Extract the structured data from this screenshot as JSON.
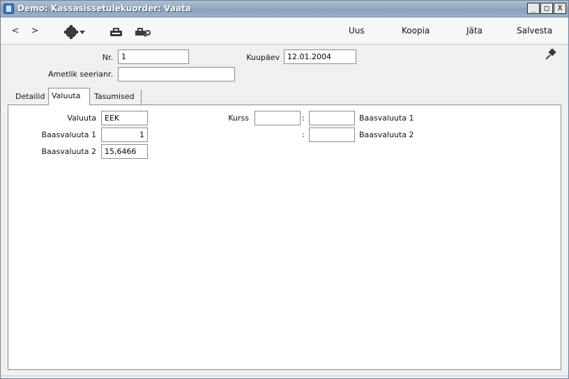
{
  "window": {
    "title": "Demo: Kassasissetulekuorder: Vaata",
    "controls": {
      "minimize": "_",
      "maximize": "□",
      "close": "X"
    }
  },
  "toolbar": {
    "back": "<",
    "forward": ">",
    "icons": [
      "gear-icon",
      "printer-icon",
      "print-preview-icon"
    ],
    "new_label": "Uus",
    "copy_label": "Koopia",
    "skip_label": "Jäta",
    "save_label": "Salvesta"
  },
  "header": {
    "nr_label": "Nr.",
    "nr_value": "1",
    "date_label": "Kuupäev",
    "date_value": "12.01.2004",
    "serial_label": "Ametlik seerianr.",
    "serial_value": ""
  },
  "tabs": [
    {
      "label": "Detailid",
      "active": false
    },
    {
      "label": "Valuuta",
      "active": true
    },
    {
      "label": "Tasumised",
      "active": false
    }
  ],
  "currency": {
    "currency_label": "Valuuta",
    "currency_value": "EEK",
    "base1_label": "Baasvaluuta 1",
    "base1_value": "1",
    "base2_label": "Baasvaluuta 2",
    "base2_value": "15,6466",
    "rate_label": "Kurss",
    "rate1_from": "",
    "rate1_to": "",
    "rate1_unit": "Baasvaluuta 1",
    "rate2_to": "",
    "rate2_unit": "Baasvaluuta 2",
    "colon": ":"
  }
}
